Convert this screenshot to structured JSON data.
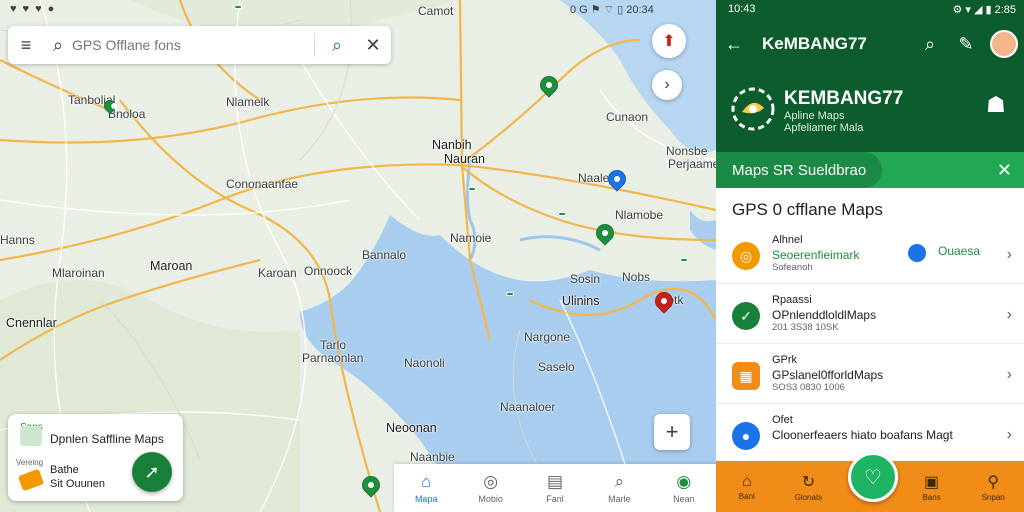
{
  "map": {
    "status_left": [
      "",
      "",
      "",
      ""
    ],
    "status_mid": "",
    "status_right": "0 G ⚑ ⌔  ▯ 20:34",
    "search": {
      "placeholder": "GPS Offlane fons",
      "value": ""
    },
    "labels": [
      {
        "t": "Tanbolial"
      },
      {
        "t": "Bnoloa"
      },
      {
        "t": "Nlamelk"
      },
      {
        "t": "Camot"
      },
      {
        "t": "Cunaon"
      },
      {
        "t": "Nanbih"
      },
      {
        "t": "Nauran"
      },
      {
        "t": "Nonsbe"
      },
      {
        "t": "Perjaame"
      },
      {
        "t": "Naale"
      },
      {
        "t": "Cononaanfae"
      },
      {
        "t": "Nlamobe"
      },
      {
        "t": "Hanns"
      },
      {
        "t": "Namoie"
      },
      {
        "t": "Mlaroinan"
      },
      {
        "t": "Maroan"
      },
      {
        "t": "Karoan"
      },
      {
        "t": "Onnoock"
      },
      {
        "t": "Bannalo"
      },
      {
        "t": "Sosin"
      },
      {
        "t": "Nobs"
      },
      {
        "t": "Nlotk"
      },
      {
        "t": "Ulinins"
      },
      {
        "t": "Cnennlar"
      },
      {
        "t": "Tarlo"
      },
      {
        "t": "Parnaonlan"
      },
      {
        "t": "Nargone"
      },
      {
        "t": "Saselo"
      },
      {
        "t": "Neoonan"
      },
      {
        "t": "Naanaloer"
      },
      {
        "t": "Naonoli"
      },
      {
        "t": "Naanbie"
      }
    ],
    "hw_labels": [
      "",
      "",
      "",
      "",
      ""
    ],
    "card": {
      "row1": "Sans",
      "row2": "Dpnlen Saffline Maps",
      "row3": "Vereing",
      "row4": "Bathe",
      "row5": "Sit Ouunen"
    },
    "nav": [
      {
        "label": "Mapa"
      },
      {
        "label": "Mobio"
      },
      {
        "label": "Fanl"
      },
      {
        "label": "Marle"
      },
      {
        "label": "Nean"
      }
    ]
  },
  "panel": {
    "status_time": "10:43",
    "status_right": "⚙ ▾ ◢ ▮ 2:85",
    "title": "KeMBANG77",
    "brand": "KEMBANG77",
    "brand_sub1": "Apline Maps",
    "brand_sub2": "Apfeliamer Mala",
    "green_tab": "Maps  SR Sueldbrao",
    "section_title": "GPS 0 cfflane Maps",
    "rows": [
      {
        "l1": "Alhnel",
        "l2": "Seoerenfieimark",
        "l3": "Sofeanoh",
        "extra": "Ouaesa",
        "color": "#f29900"
      },
      {
        "l1": "Rpaassi",
        "l2": "OPnlenddloldlMaps",
        "l3": "201 3S38 10SK",
        "extra": "",
        "color": "#188038"
      },
      {
        "l1": "GPrk",
        "l2": "GPslanel0fforldMaps",
        "l3": "SOS3 0830 1006",
        "extra": "",
        "color": "#f28c19"
      },
      {
        "l1": "Ofet",
        "l2": "Cloonerfeaers hiato boafans Magt",
        "l3": "",
        "extra": "",
        "color": "#1a73e8"
      }
    ],
    "nav": [
      {
        "label": "Banl"
      },
      {
        "label": "Glonats"
      },
      {
        "label": ""
      },
      {
        "label": "Bans"
      },
      {
        "label": "Snpan"
      }
    ],
    "colors": {
      "header": "#0d5c2e",
      "accent": "#22a854",
      "nav": "#f28c19"
    }
  }
}
